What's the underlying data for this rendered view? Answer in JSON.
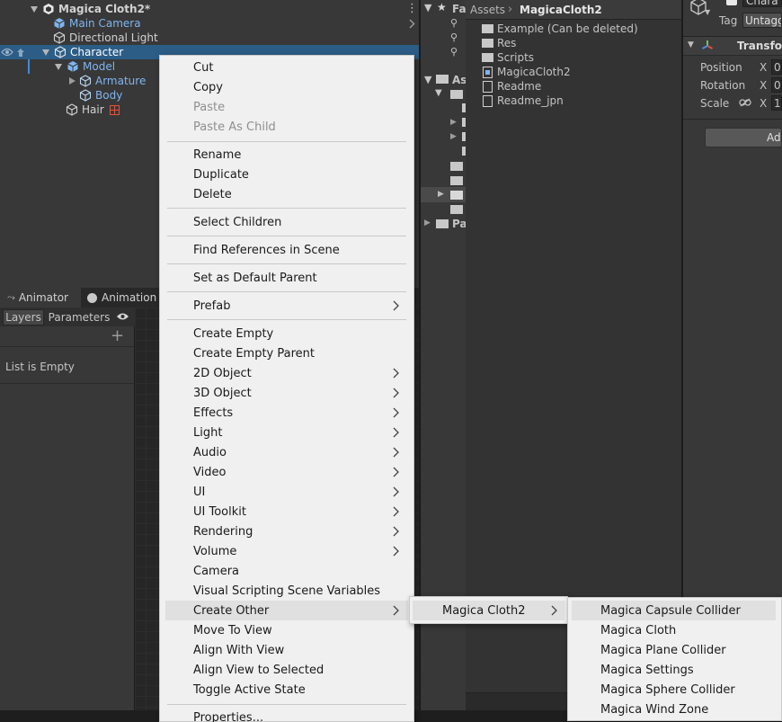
{
  "hierarchy": {
    "scene_name": "Magica Cloth2*",
    "items": [
      {
        "label": "Main Camera"
      },
      {
        "label": "Directional Light"
      },
      {
        "label": "Character"
      },
      {
        "label": "Model"
      },
      {
        "label": "Armature"
      },
      {
        "label": "Body"
      },
      {
        "label": "Hair"
      }
    ]
  },
  "animator": {
    "tabs": [
      "Animator",
      "Animation"
    ],
    "subtabs": [
      "Layers",
      "Parameters"
    ],
    "empty_text": "List is Empty"
  },
  "project": {
    "favorites_label": "Fa",
    "assets_label": "As",
    "packages_label": "Pa",
    "breadcrumb": {
      "root": "Assets",
      "current": "MagicaCloth2"
    },
    "items": [
      {
        "label": "Example (Can be deleted)",
        "icon": "folder-icon"
      },
      {
        "label": "Res",
        "icon": "folder-icon"
      },
      {
        "label": "Scripts",
        "icon": "folder-icon"
      },
      {
        "label": "MagicaCloth2",
        "icon": "file-icon"
      },
      {
        "label": "Readme",
        "icon": "file-icon"
      },
      {
        "label": "Readme_jpn",
        "icon": "file-icon"
      }
    ]
  },
  "inspector": {
    "name_value": "Chara",
    "tag_label": "Tag",
    "tag_value": "Untagg",
    "transform_label": "Transfor",
    "fields": [
      {
        "label": "Position",
        "axis": "X",
        "value": "0"
      },
      {
        "label": "Rotation",
        "axis": "X",
        "value": "0"
      },
      {
        "label": "Scale",
        "axis": "X",
        "value": "1"
      }
    ],
    "add_button": "Add"
  },
  "context_menu": {
    "items": [
      {
        "label": "Cut"
      },
      {
        "label": "Copy"
      },
      {
        "label": "Paste"
      },
      {
        "label": "Paste As Child"
      },
      {
        "label": "Rename"
      },
      {
        "label": "Duplicate"
      },
      {
        "label": "Delete"
      },
      {
        "label": "Select Children"
      },
      {
        "label": "Find References in Scene"
      },
      {
        "label": "Set as Default Parent"
      },
      {
        "label": "Prefab"
      },
      {
        "label": "Create Empty"
      },
      {
        "label": "Create Empty Parent"
      },
      {
        "label": "2D Object"
      },
      {
        "label": "3D Object"
      },
      {
        "label": "Effects"
      },
      {
        "label": "Light"
      },
      {
        "label": "Audio"
      },
      {
        "label": "Video"
      },
      {
        "label": "UI"
      },
      {
        "label": "UI Toolkit"
      },
      {
        "label": "Rendering"
      },
      {
        "label": "Volume"
      },
      {
        "label": "Camera"
      },
      {
        "label": "Visual Scripting Scene Variables"
      },
      {
        "label": "Create Other"
      },
      {
        "label": "Move To View"
      },
      {
        "label": "Align With View"
      },
      {
        "label": "Align View to Selected"
      },
      {
        "label": "Toggle Active State"
      },
      {
        "label": "Properties..."
      }
    ]
  },
  "submenu_create_other": {
    "items": [
      {
        "label": "Magica Cloth2"
      }
    ]
  },
  "submenu_magica": {
    "items": [
      {
        "label": "Magica Capsule Collider"
      },
      {
        "label": "Magica Cloth"
      },
      {
        "label": "Magica Plane Collider"
      },
      {
        "label": "Magica Settings"
      },
      {
        "label": "Magica Sphere Collider"
      },
      {
        "label": "Magica Wind Zone"
      }
    ]
  },
  "colors": {
    "selection": "#2c5d87",
    "prefab_blue": "#7fb5ef",
    "menu_bg": "#f0f0f0",
    "menu_highlight": "#e0e0e0"
  }
}
